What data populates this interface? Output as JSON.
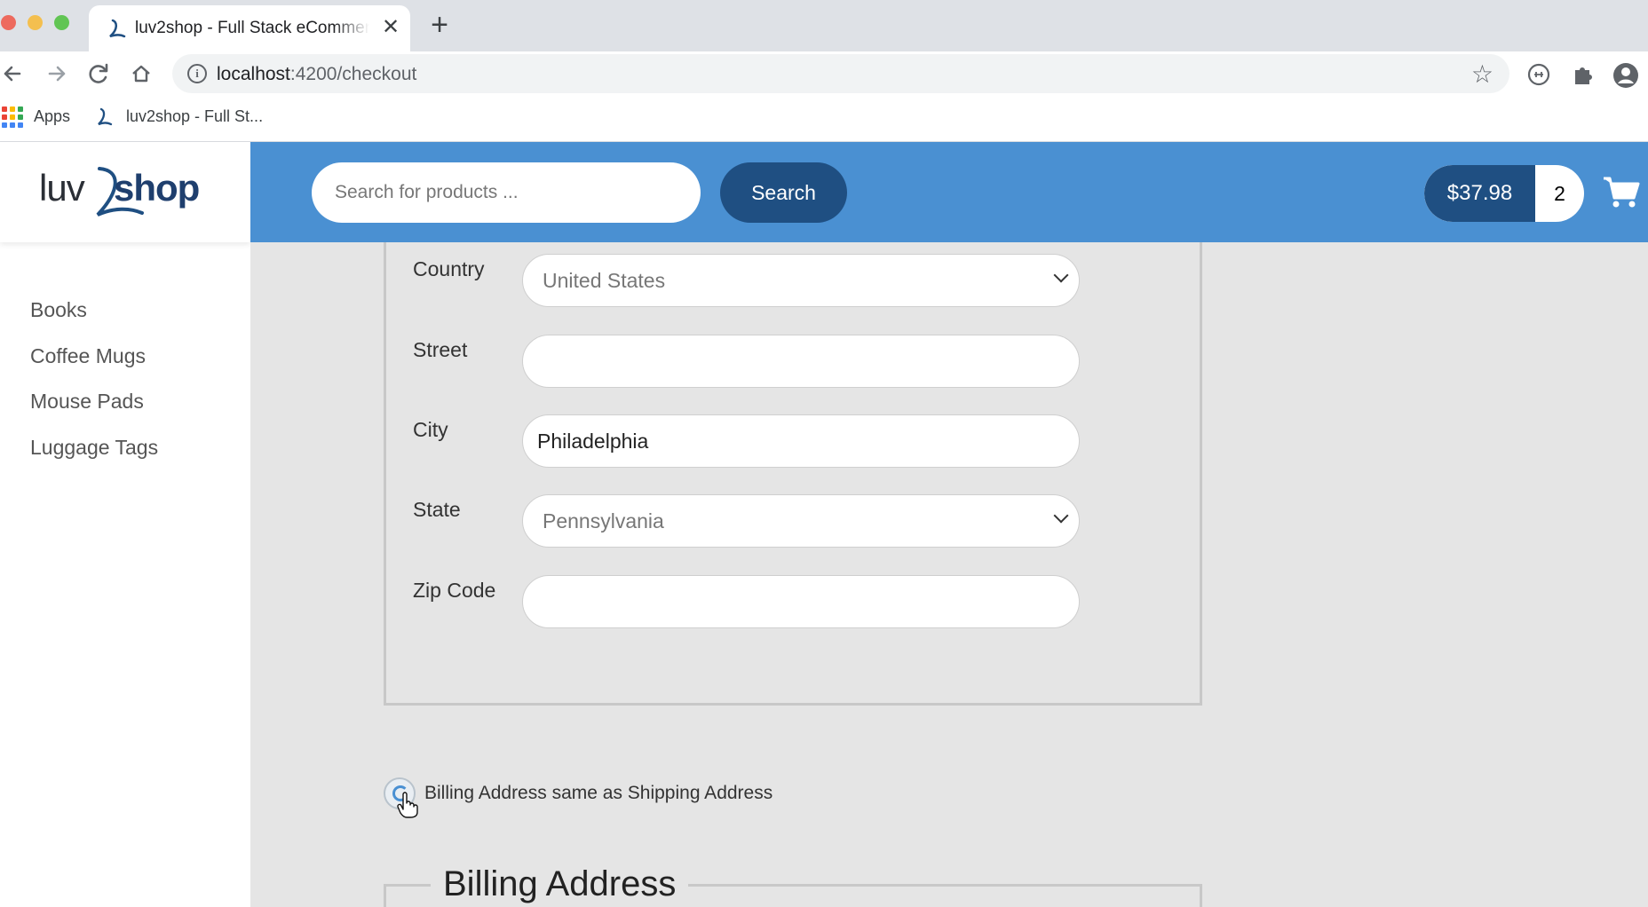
{
  "browser": {
    "tab_title": "luv2shop - Full Stack eCommerce",
    "url_host": "localhost",
    "url_rest": ":4200/checkout",
    "bookmarks": [
      {
        "label": "Apps"
      },
      {
        "label": "luv2shop - Full St..."
      }
    ]
  },
  "header": {
    "search_placeholder": "Search for products ...",
    "search_button": "Search",
    "cart_total": "$37.98",
    "cart_quantity": "2"
  },
  "sidebar": {
    "logo_text": "luv2shop",
    "categories": [
      {
        "label": "Books"
      },
      {
        "label": "Coffee Mugs"
      },
      {
        "label": "Mouse Pads"
      },
      {
        "label": "Luggage Tags"
      }
    ]
  },
  "shipping": {
    "country": {
      "label": "Country",
      "value": "United States"
    },
    "street": {
      "label": "Street",
      "value": ""
    },
    "city": {
      "label": "City",
      "value": "Philadelphia"
    },
    "state": {
      "label": "State",
      "value": "Pennsylvania"
    },
    "zip": {
      "label": "Zip Code",
      "value": ""
    }
  },
  "billing_same": {
    "label": "Billing Address same as Shipping Address",
    "checked": false
  },
  "billing": {
    "legend": "Billing Address"
  },
  "colors": {
    "header_blue": "#4a90d2",
    "button_navy": "#1f4f82",
    "content_gray": "#e5e5e5"
  }
}
